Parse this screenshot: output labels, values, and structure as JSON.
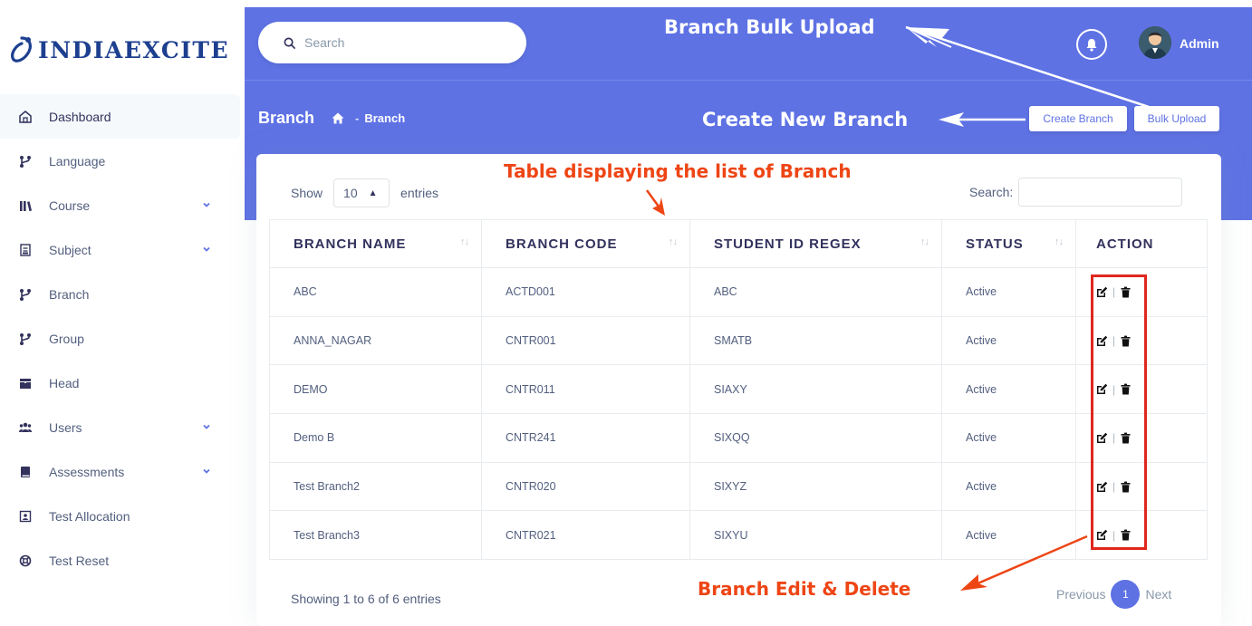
{
  "brand": {
    "name": "INDIAEXCITE"
  },
  "sidebar": {
    "items": [
      {
        "label": "Dashboard",
        "icon": "home-icon",
        "active": true
      },
      {
        "label": "Language",
        "icon": "branch-icon"
      },
      {
        "label": "Course",
        "icon": "books-icon",
        "expandable": true
      },
      {
        "label": "Subject",
        "icon": "document-icon",
        "expandable": true
      },
      {
        "label": "Branch",
        "icon": "branch-icon"
      },
      {
        "label": "Group",
        "icon": "branch-icon"
      },
      {
        "label": "Head",
        "icon": "folder-icon"
      },
      {
        "label": "Users",
        "icon": "users-icon",
        "expandable": true
      },
      {
        "label": "Assessments",
        "icon": "book-icon",
        "expandable": true
      },
      {
        "label": "Test Allocation",
        "icon": "contact-icon"
      },
      {
        "label": "Test Reset",
        "icon": "life-ring-icon"
      }
    ]
  },
  "header": {
    "search_placeholder": "Search",
    "user_name": "Admin",
    "page_title": "Branch",
    "breadcrumb_sep": "-",
    "breadcrumb_current": "Branch",
    "create_button": "Create Branch",
    "bulk_button": "Bulk Upload"
  },
  "table_controls": {
    "show_label": "Show",
    "entries_value": "10",
    "entries_label": "entries",
    "search_label": "Search:"
  },
  "table": {
    "columns": [
      "BRANCH NAME",
      "BRANCH CODE",
      "STUDENT ID REGEX",
      "STATUS",
      "ACTION"
    ],
    "rows": [
      {
        "name": "ABC",
        "code": "ACTD001",
        "regex": "ABC",
        "status": "Active"
      },
      {
        "name": "ANNA_NAGAR",
        "code": "CNTR001",
        "regex": "SMATB",
        "status": "Active"
      },
      {
        "name": "DEMO",
        "code": "CNTR011",
        "regex": "SIAXY",
        "status": "Active"
      },
      {
        "name": "Demo B",
        "code": "CNTR241",
        "regex": "SIXQQ",
        "status": "Active"
      },
      {
        "name": "Test Branch2",
        "code": "CNTR020",
        "regex": "SIXYZ",
        "status": "Active"
      },
      {
        "name": "Test Branch3",
        "code": "CNTR021",
        "regex": "SIXYU",
        "status": "Active"
      }
    ]
  },
  "footer": {
    "info": "Showing 1 to 6 of 6 entries",
    "previous": "Previous",
    "current_page": "1",
    "next": "Next"
  },
  "annotations": {
    "bulk_upload": "Branch Bulk Upload",
    "create_new": "Create New Branch",
    "table_list": "Table displaying the list of Branch",
    "edit_delete": "Branch Edit & Delete"
  },
  "colors": {
    "primary": "#5e72e4",
    "annotation_red": "#ee4515",
    "highlight_box": "#e0271d"
  }
}
